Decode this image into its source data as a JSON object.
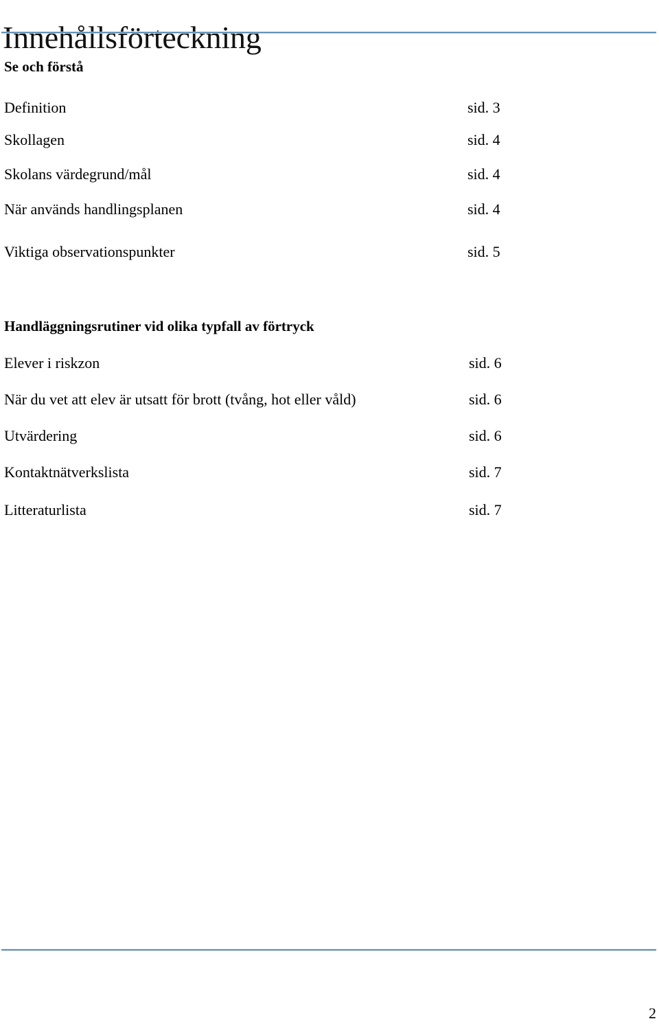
{
  "document": {
    "title": "Innehållsförteckning",
    "page_number": "2",
    "rule_color": "#4a7fa8"
  },
  "sections": [
    {
      "heading": "Se och förstå",
      "entries": [
        {
          "label": "Definition",
          "page": "sid. 3"
        },
        {
          "label": "Skollagen",
          "page": "sid. 4"
        },
        {
          "label": "Skolans värdegrund/mål",
          "page": "sid. 4"
        },
        {
          "label": "När används handlingsplanen",
          "page": "sid. 4"
        },
        {
          "label": "Viktiga observationspunkter",
          "page": "sid. 5"
        }
      ]
    },
    {
      "heading": "Handläggningsrutiner vid olika typfall av förtryck",
      "entries": [
        {
          "label": "Elever i riskzon",
          "page": "sid. 6"
        },
        {
          "label": "När du vet att elev är utsatt för brott (tvång, hot eller våld)",
          "page": "sid. 6"
        },
        {
          "label": "Utvärdering",
          "page": "sid. 6"
        },
        {
          "label": "Kontaktnätverkslista",
          "page": "sid. 7"
        },
        {
          "label": "Litteraturlista",
          "page": "sid. 7"
        }
      ]
    }
  ]
}
